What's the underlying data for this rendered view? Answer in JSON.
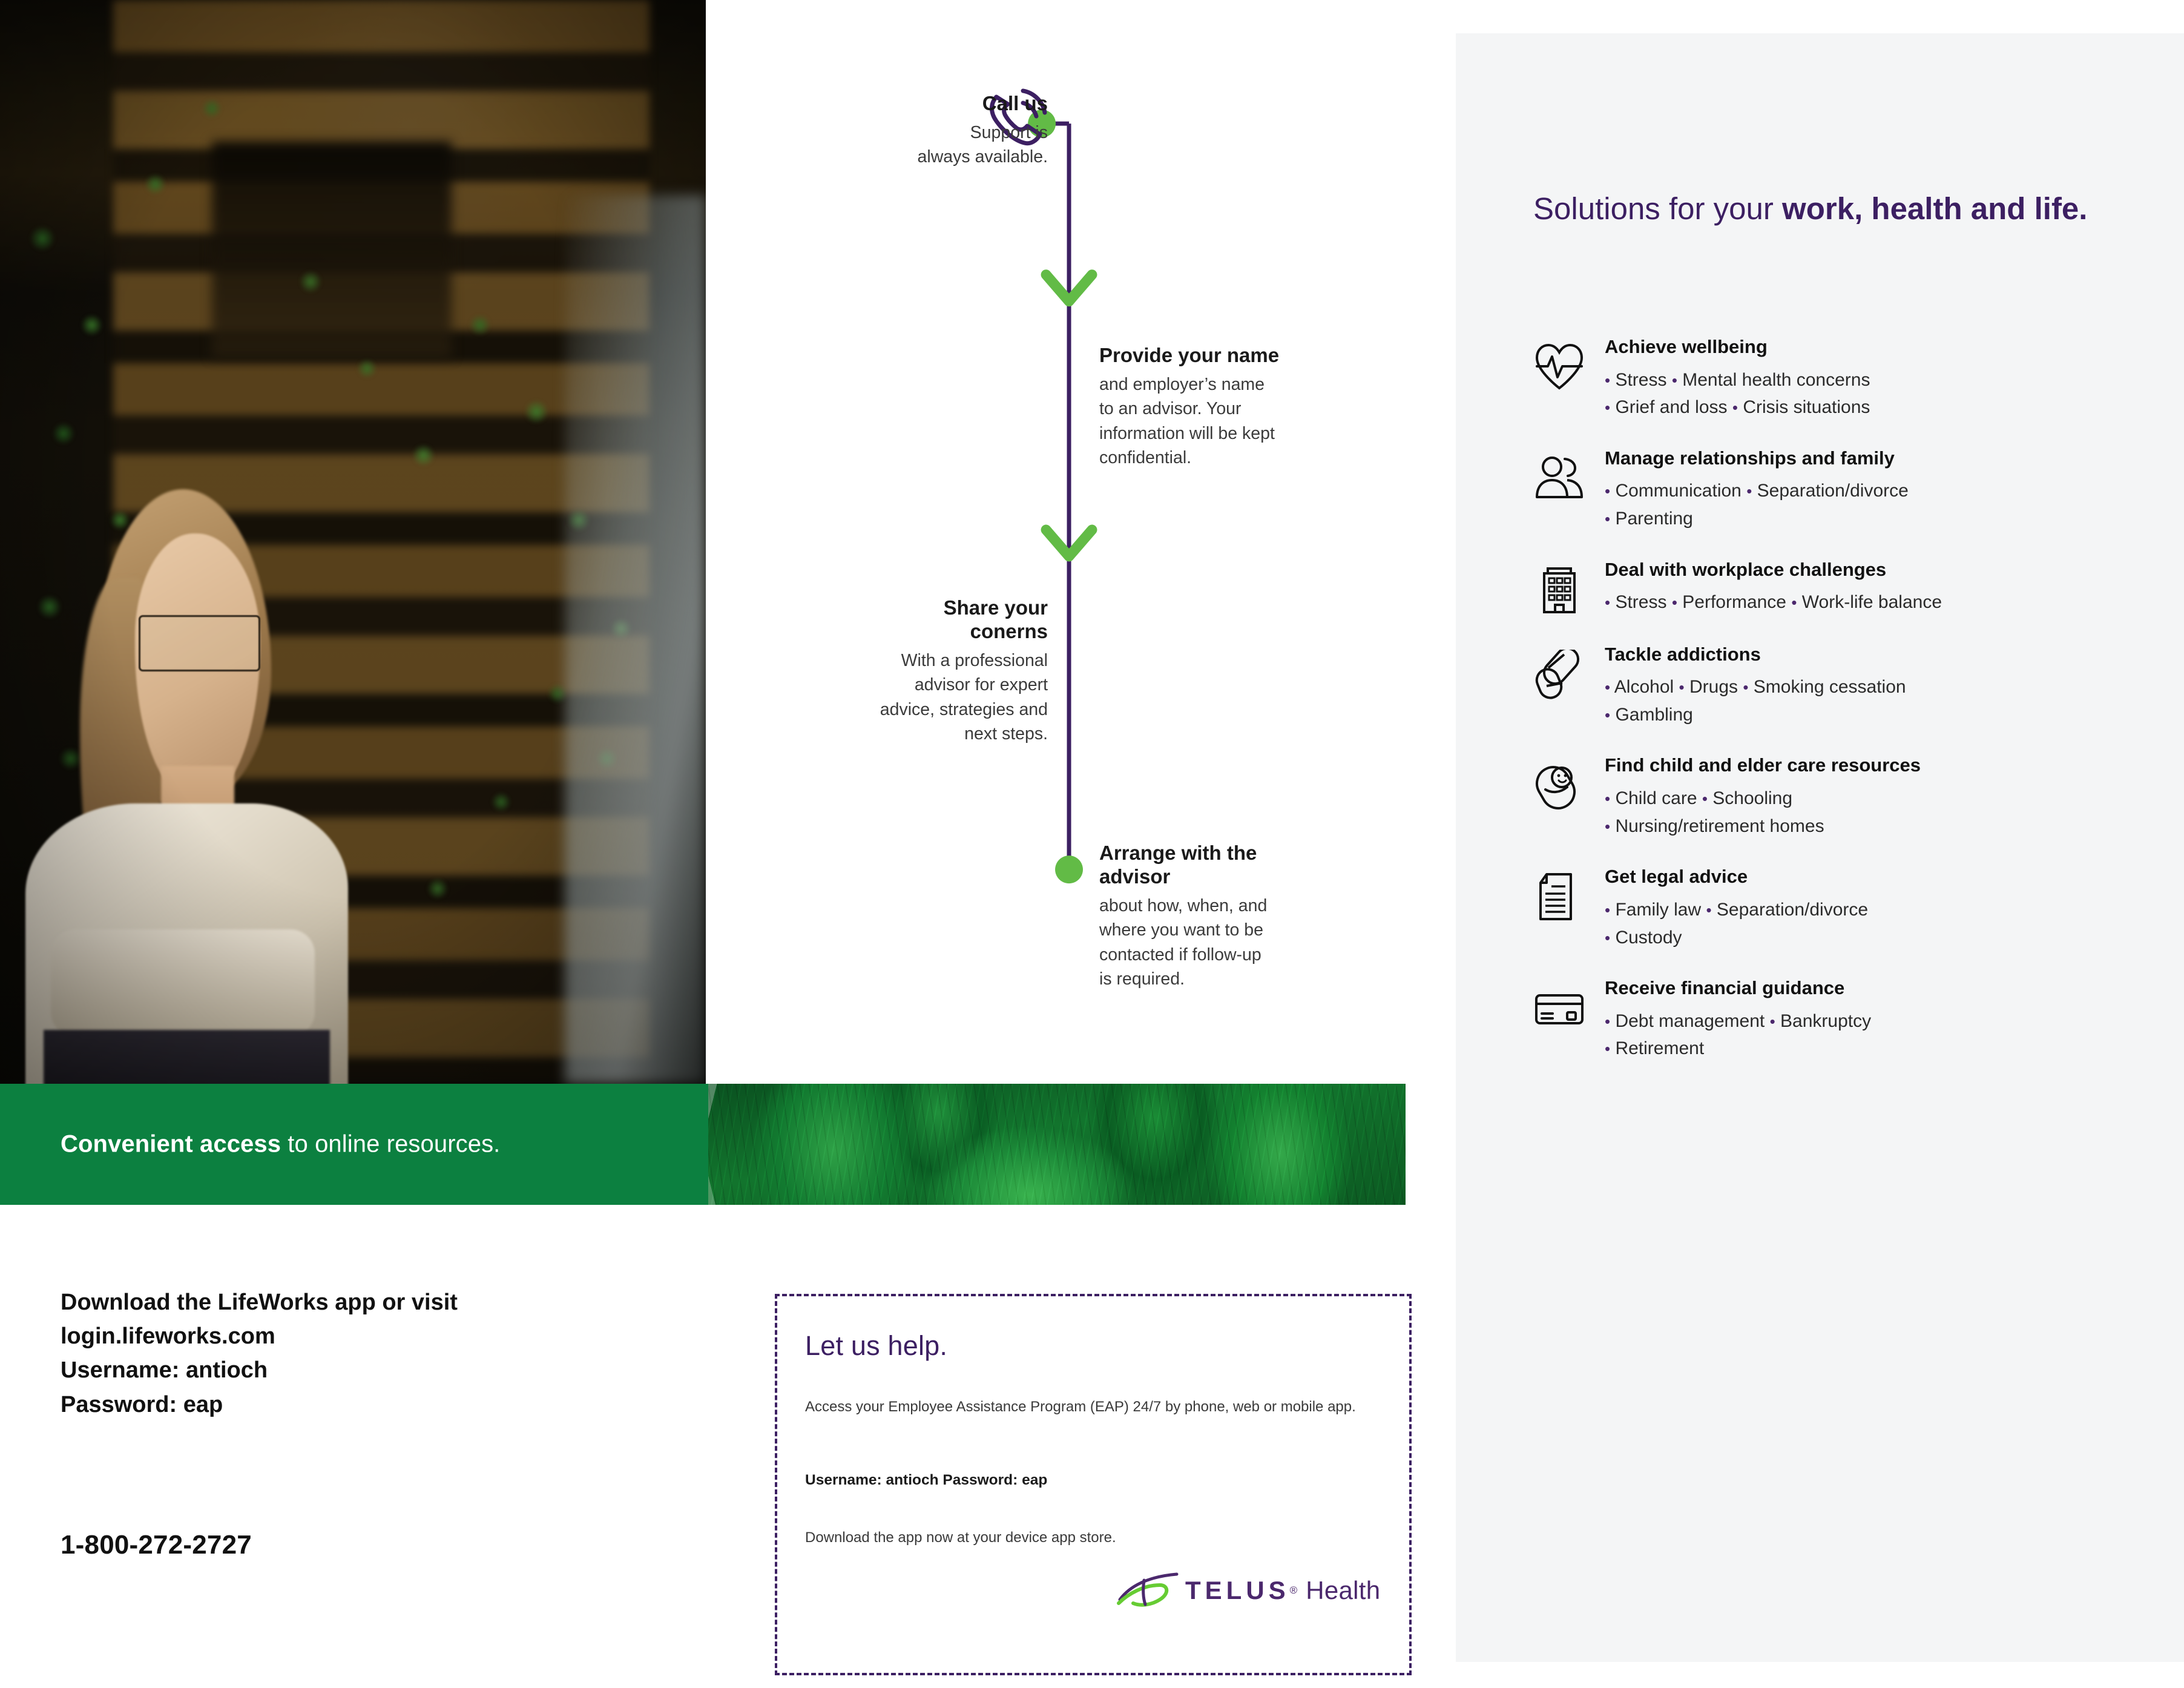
{
  "hero": {
    "alt": "woman-with-glasses-in-front-of-plant-wall"
  },
  "green_banner": {
    "bold_text": "Convenient access",
    "rest_text": " to online resources.",
    "background_color": "#0c8040",
    "image_alt": "green-succulent-closeup"
  },
  "timeline": {
    "line_color": "#3c1f62",
    "node_color": "#62bb46",
    "steps": [
      {
        "icon": "phone-icon",
        "title": "Call us",
        "body": "Support is\nalways available."
      },
      {
        "icon": "id-card-icon",
        "title": "Provide your name",
        "body": "and employer’s name\nto an advisor. Your\ninformation will be kept\nconfidential."
      },
      {
        "icon": "speech-bubbles-icon",
        "title": "Share your\nconerns",
        "body": "With a professional\nadvisor for expert\nadvice, strategies and\nnext steps."
      },
      {
        "icon": "calendar-31-icon",
        "title": "Arrange with the\nadvisor",
        "body": "about how, when, and\nwhere you want to be\ncontacted if follow-up\nis required."
      }
    ]
  },
  "download_block": {
    "lines": [
      "Download the LifeWorks app or visit",
      "login.lifeworks.com",
      "Username: antioch",
      "Password: eap"
    ],
    "phone": "1-800-272-2727"
  },
  "help_card": {
    "title": "Let us help.",
    "subtitle": "Access your Employee Assistance Program (EAP) 24/7 by phone, web or mobile app.",
    "credentials": "Username: antioch Password: eap",
    "download_note": "Download the app now at your device app store.",
    "logo": {
      "brand": "TELUS",
      "registered": "®",
      "suffix": "Health",
      "brand_color": "#4b286d",
      "swoosh_color": "#66cc33"
    }
  },
  "solutions": {
    "heading_normal": "Solutions for your ",
    "heading_bold": "work, health and life.",
    "heading_color": "#3c1f62",
    "panel_color": "#f4f5f6",
    "items": [
      {
        "icon": "heart-pulse-icon",
        "name": "Achieve wellbeing",
        "bullets_line1": [
          "Stress",
          "Mental health concerns"
        ],
        "bullets_line2": [
          "Grief and loss",
          "Crisis situations"
        ]
      },
      {
        "icon": "two-people-icon",
        "name": "Manage relationships and family",
        "bullets_line1": [
          "Communication",
          "Separation/divorce"
        ],
        "bullets_line2": [
          "Parenting"
        ]
      },
      {
        "icon": "office-building-icon",
        "name": "Deal with workplace challenges",
        "bullets_line1": [
          "Stress",
          "Performance",
          "Work-life balance"
        ],
        "bullets_line2": []
      },
      {
        "icon": "pills-icon",
        "name": "Tackle addictions",
        "bullets_line1": [
          "Alcohol",
          "Drugs",
          "Smoking cessation"
        ],
        "bullets_line2": [
          "Gambling"
        ]
      },
      {
        "icon": "swaddled-baby-icon",
        "name": "Find child and elder care resources",
        "bullets_line1": [
          "Child care",
          "Schooling"
        ],
        "bullets_line2": [
          "Nursing/retirement homes"
        ]
      },
      {
        "icon": "legal-document-icon",
        "name": "Get legal advice",
        "bullets_line1": [
          "Family law",
          "Separation/divorce"
        ],
        "bullets_line2": [
          "Custody"
        ]
      },
      {
        "icon": "credit-card-icon",
        "name": "Receive financial guidance",
        "bullets_line1": [
          "Debt management",
          "Bankruptcy"
        ],
        "bullets_line2": [
          "Retirement"
        ]
      }
    ]
  }
}
